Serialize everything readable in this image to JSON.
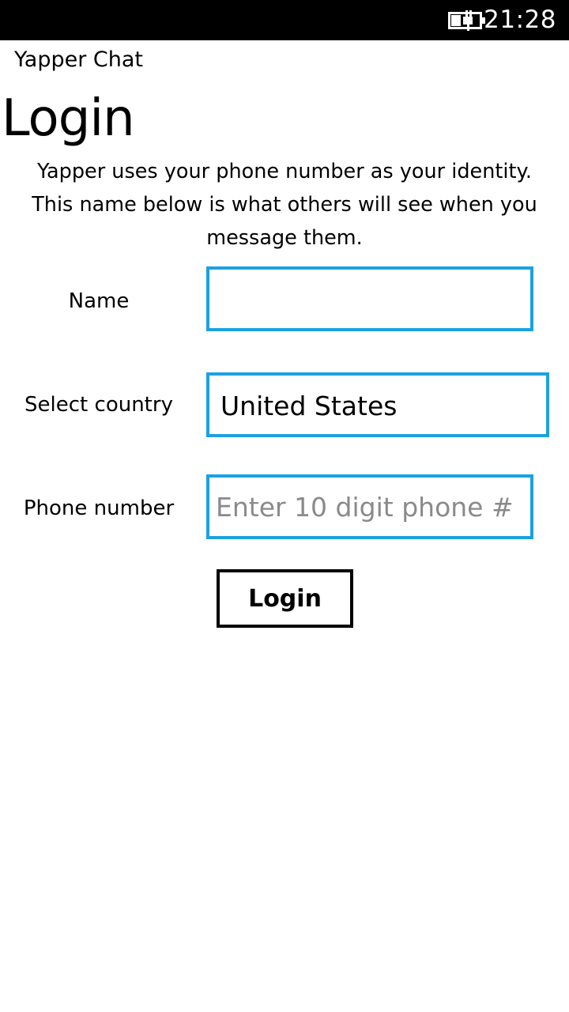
{
  "status_bar": {
    "time": "21:28",
    "battery_icon": "battery-charging-icon"
  },
  "app": {
    "title": "Yapper Chat"
  },
  "page": {
    "title": "Login",
    "intro": "Yapper uses your phone number as your identity. This name below is what others will see when you message them."
  },
  "form": {
    "name_label": "Name",
    "name_value": "",
    "country_label": "Select country",
    "country_value": "United States",
    "phone_label": "Phone number",
    "phone_placeholder": "Enter 10 digit phone #",
    "phone_value": ""
  },
  "actions": {
    "login_label": "Login"
  },
  "colors": {
    "accent": "#1ba1e2",
    "background": "#ffffff",
    "status_bar": "#000000"
  }
}
